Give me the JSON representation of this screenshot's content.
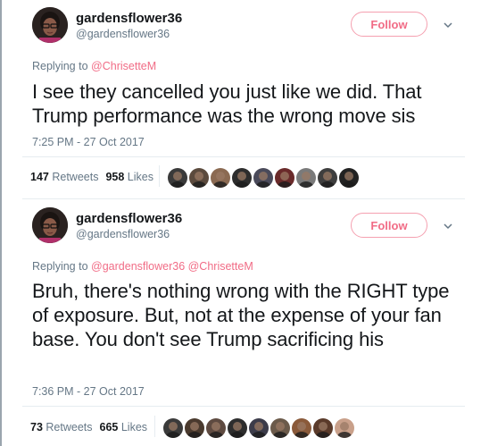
{
  "tweets": [
    {
      "author_name": "gardensflower36",
      "author_handle": "@gardensflower36",
      "follow_label": "Follow",
      "reply_prefix": "Replying to",
      "reply_mentions": "@ChrisetteM",
      "text": "I see they cancelled you just like we did. That Trump performance was the wrong move sis",
      "timestamp": "7:25 PM - 27 Oct 2017",
      "retweets_count": "147",
      "retweets_label": "Retweets",
      "likes_count": "958",
      "likes_label": "Likes",
      "likers": [
        {
          "name": "liker-avatar",
          "color": "#3a3a3a"
        },
        {
          "name": "liker-avatar",
          "color": "#5b4a3d"
        },
        {
          "name": "liker-avatar",
          "color": "#8b6a52"
        },
        {
          "name": "liker-avatar",
          "color": "#2d2d2d"
        },
        {
          "name": "liker-avatar",
          "color": "#4a4a5a"
        },
        {
          "name": "liker-avatar",
          "color": "#6a2a2a"
        },
        {
          "name": "liker-avatar",
          "color": "#7a7a7a"
        },
        {
          "name": "liker-avatar",
          "color": "#3e3e3e"
        },
        {
          "name": "liker-avatar",
          "color": "#222222"
        }
      ]
    },
    {
      "author_name": "gardensflower36",
      "author_handle": "@gardensflower36",
      "follow_label": "Follow",
      "reply_prefix": "Replying to",
      "reply_mentions": "@gardensflower36 @ChrisetteM",
      "text": "Bruh, there's nothing wrong with the RIGHT type of exposure. But, not at the expense of your fan base. You don't see Trump sacrificing his",
      "timestamp": "7:36 PM - 27 Oct 2017",
      "retweets_count": "73",
      "retweets_label": "Retweets",
      "likes_count": "665",
      "likes_label": "Likes",
      "likers": [
        {
          "name": "liker-avatar",
          "color": "#3a3a3a"
        },
        {
          "name": "liker-avatar",
          "color": "#4a3a2e"
        },
        {
          "name": "liker-avatar",
          "color": "#5e4a40"
        },
        {
          "name": "liker-avatar",
          "color": "#2e2e2e"
        },
        {
          "name": "liker-avatar",
          "color": "#3c3c4a"
        },
        {
          "name": "liker-avatar",
          "color": "#6b5a4a"
        },
        {
          "name": "liker-avatar",
          "color": "#8a5a3a"
        },
        {
          "name": "liker-avatar",
          "color": "#5a3a2a"
        },
        {
          "name": "liker-avatar",
          "color": "#c9a08a"
        }
      ]
    }
  ],
  "colors": {
    "accent": "#f16c86",
    "muted": "#657786",
    "text": "#14171a",
    "divider": "#e6ecf0"
  }
}
